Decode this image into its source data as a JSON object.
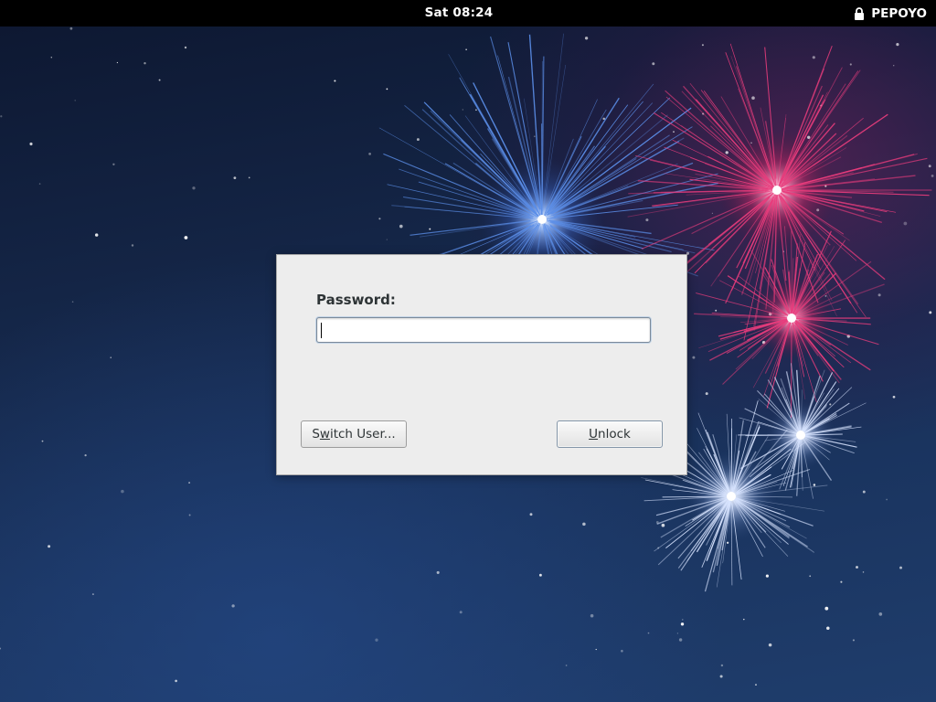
{
  "topbar": {
    "clock": "Sat 08:24",
    "username": "PEPOYO",
    "lock_icon": "padlock-icon"
  },
  "dialog": {
    "password_label": "Password:",
    "password_value": "",
    "switch_user": {
      "before": "S",
      "mnemonic": "w",
      "after": "itch User..."
    },
    "unlock": {
      "before": "",
      "mnemonic": "U",
      "after": "nlock"
    }
  },
  "colors": {
    "topbar_bg": "#000000",
    "dialog_bg": "#ededed",
    "firework_blue": "#5b8ee8",
    "firework_pink": "#e83c7c",
    "firework_white": "#d8e4ff"
  }
}
